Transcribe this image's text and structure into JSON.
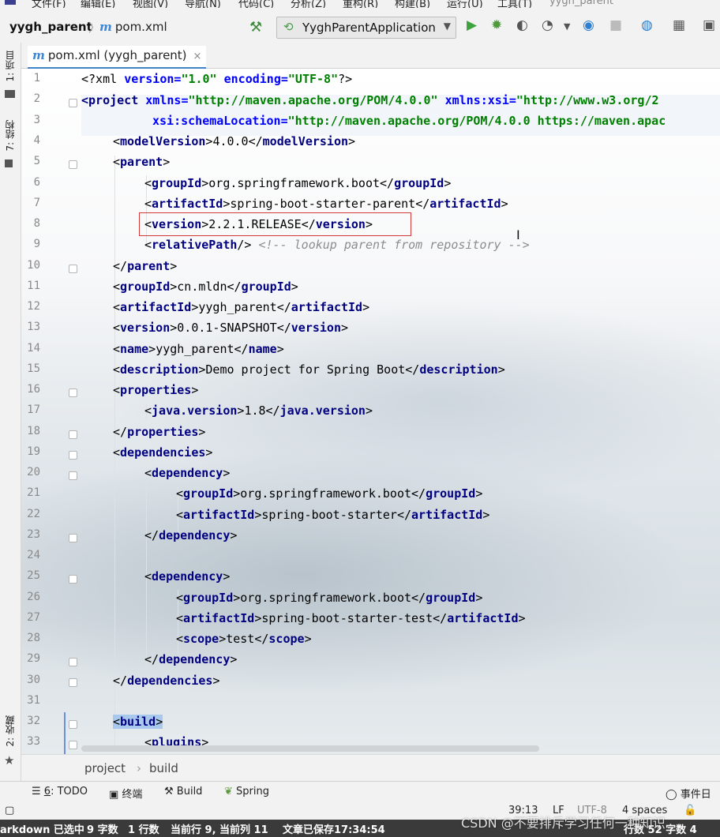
{
  "menu": [
    "文件(F)",
    "编辑(E)",
    "视图(V)",
    "导航(N)",
    "代码(C)",
    "分析(Z)",
    "重构(R)",
    "构建(B)",
    "运行(U)",
    "工具(T)",
    "yygh_parent"
  ],
  "nav": {
    "project": "yygh_parent",
    "file": "pom.xml",
    "run_config": "YyghParentApplication"
  },
  "left_strip": {
    "project": "1: 项目",
    "structure": "7: 结构",
    "favorites": "2: 收藏"
  },
  "tab": {
    "label": "pom.xml (yygh_parent)",
    "close": "×",
    "file_letter": "m"
  },
  "code_lines": [
    "1",
    "2",
    "3",
    "4",
    "5",
    "6",
    "7",
    "8",
    "9",
    "10",
    "11",
    "12",
    "13",
    "14",
    "15",
    "16",
    "17",
    "18",
    "19",
    "20",
    "21",
    "22",
    "23",
    "24",
    "25",
    "26",
    "27",
    "28",
    "29",
    "30",
    "31",
    "32",
    "33"
  ],
  "code": {
    "l1_a": "<?xml ",
    "l1_b": "version",
    "l1_c": "=",
    "l1_d": "\"1.0\"",
    "l1_e": " encoding",
    "l1_f": "=",
    "l1_g": "\"UTF-8\"",
    "l1_h": "?>",
    "l2_a": "<project ",
    "l2_b": "xmlns",
    "l2_c": "=",
    "l2_d": "\"http://maven.apache.org/POM/4.0.0\"",
    "l2_e": " xmlns:xsi",
    "l2_f": "=",
    "l2_g": "\"http://www.w3.org/2",
    "l3_a": "xsi:schemaLocation",
    "l3_b": "=",
    "l3_c": "\"http://maven.apache.org/POM/4.0.0 https://maven.apac",
    "l4": [
      "modelVersion",
      "4.0.0"
    ],
    "l5": "parent",
    "l6": [
      "groupId",
      "org.springframework.boot"
    ],
    "l7": [
      "artifactId",
      "spring-boot-starter-parent"
    ],
    "l8": [
      "version",
      "2.2.1.RELEASE"
    ],
    "l9_tag": "relativePath",
    "l9_comment": "<!-- lookup parent from repository -->",
    "l10": "parent",
    "l11": [
      "groupId",
      "cn.mldn"
    ],
    "l12": [
      "artifactId",
      "yygh_parent"
    ],
    "l13": [
      "version",
      "0.0.1-SNAPSHOT"
    ],
    "l14": [
      "name",
      "yygh_parent"
    ],
    "l15": [
      "description",
      "Demo project for Spring Boot"
    ],
    "l16": "properties",
    "l17": [
      "java.version",
      "1.8"
    ],
    "l18": "properties",
    "l19": "dependencies",
    "l20": "dependency",
    "l21": [
      "groupId",
      "org.springframework.boot"
    ],
    "l22": [
      "artifactId",
      "spring-boot-starter"
    ],
    "l23": "dependency",
    "l25": "dependency",
    "l26": [
      "groupId",
      "org.springframework.boot"
    ],
    "l27": [
      "artifactId",
      "spring-boot-starter-test"
    ],
    "l28": [
      "scope",
      "test"
    ],
    "l29": "dependency",
    "l30": "dependencies",
    "l32": "build",
    "l33": "plugins"
  },
  "editor_breadcrumb": [
    "project",
    "build"
  ],
  "bottom_tools": {
    "todo_num": "6",
    "todo": ": TODO",
    "terminal": "终端",
    "build": "Build",
    "spring": "Spring",
    "event_log": "事件日志"
  },
  "status": {
    "position": "39:13",
    "line_sep": "LF",
    "encoding": "UTF-8",
    "indent": "4 spaces"
  },
  "markdown_bar": {
    "mode": "arkdown 已选中",
    "words": "9 字数",
    "lines": "1 行数",
    "cur": "当前行 9, 当前列 11",
    "saved": "文章已保存17:34:54",
    "right": "行数 52 字数 4"
  },
  "watermark": "CSDN @不要排斥学习任何一种知识"
}
